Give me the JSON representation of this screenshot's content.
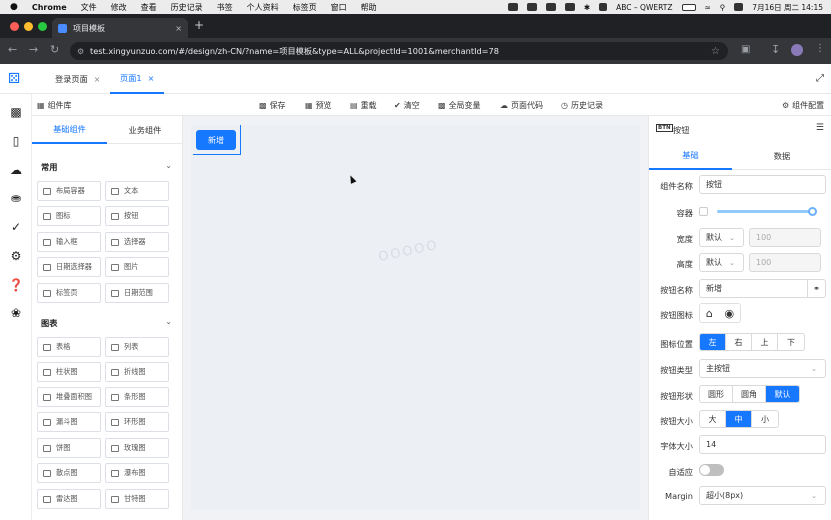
{
  "menubar": {
    "apple": "",
    "items": [
      "Chrome",
      "文件",
      "修改",
      "查看",
      "历史记录",
      "书签",
      "个人资料",
      "标签页",
      "窗口",
      "帮助"
    ],
    "keyboard": "ABC – QWERTZ",
    "datetime": "7月16日 周二  14:15"
  },
  "browser": {
    "tab_title": "项目模板",
    "url": "test.xingyunzuo.com/#/design/zh-CN/?name=项目模板&type=ALL&projectId=1001&merchantId=78"
  },
  "app": {
    "page_tabs": [
      {
        "label": "登录页面",
        "close": "×"
      },
      {
        "label": "页面1",
        "close": "×"
      }
    ],
    "library_label": "组件库",
    "toolbar": [
      {
        "icon": "save-icon",
        "label": "保存"
      },
      {
        "icon": "preview-icon",
        "label": "预览"
      },
      {
        "icon": "reload-icon",
        "label": "重载"
      },
      {
        "icon": "clear-icon",
        "label": "清空"
      },
      {
        "icon": "global-var-icon",
        "label": "全局变量"
      },
      {
        "icon": "code-icon",
        "label": "页面代码"
      },
      {
        "icon": "history-icon",
        "label": "历史记录"
      }
    ],
    "config_label": "组件配置"
  },
  "left_panel": {
    "tabs": [
      "基础组件",
      "业务组件"
    ],
    "sections": [
      {
        "title": "常用",
        "items": [
          "布局容器",
          "文本",
          "图标",
          "按钮",
          "输入框",
          "选择器",
          "日期选择器",
          "图片",
          "标签页",
          "日期范围"
        ]
      },
      {
        "title": "图表",
        "items": [
          "表格",
          "列表",
          "柱状图",
          "折线图",
          "堆叠面积图",
          "条形图",
          "漏斗图",
          "环形图",
          "饼图",
          "玫瑰图",
          "散点图",
          "瀑布图",
          "雷达图",
          "甘特图"
        ]
      }
    ]
  },
  "canvas": {
    "button_label": "新增",
    "watermark": "OOOOO"
  },
  "right_panel": {
    "badge": "BTN",
    "title": "按钮",
    "tabs": [
      "基础",
      "数据"
    ],
    "fields": {
      "component_name_label": "组件名称",
      "component_name_value": "按钮",
      "container_label": "容器",
      "width_label": "宽度",
      "width_mode": "默认",
      "width_value": "100",
      "height_label": "高度",
      "height_mode": "默认",
      "height_value": "100",
      "btn_name_label": "按钮名称",
      "btn_name_value": "新增",
      "btn_icon_label": "按钮图标",
      "icon_pos_label": "图标位置",
      "icon_pos_options": [
        "左",
        "右",
        "上",
        "下"
      ],
      "btn_type_label": "按钮类型",
      "btn_type_value": "主按钮",
      "btn_shape_label": "按钮形状",
      "btn_shape_options": [
        "圆形",
        "圆角",
        "默认"
      ],
      "btn_size_label": "按钮大小",
      "btn_size_options": [
        "大",
        "中",
        "小"
      ],
      "font_size_label": "字体大小",
      "font_size_value": "14",
      "adaptive_label": "自适应",
      "margin_label": "Margin",
      "margin_value": "超小(8px)"
    },
    "slider_level": 1.0,
    "accent": "#1677ff"
  }
}
